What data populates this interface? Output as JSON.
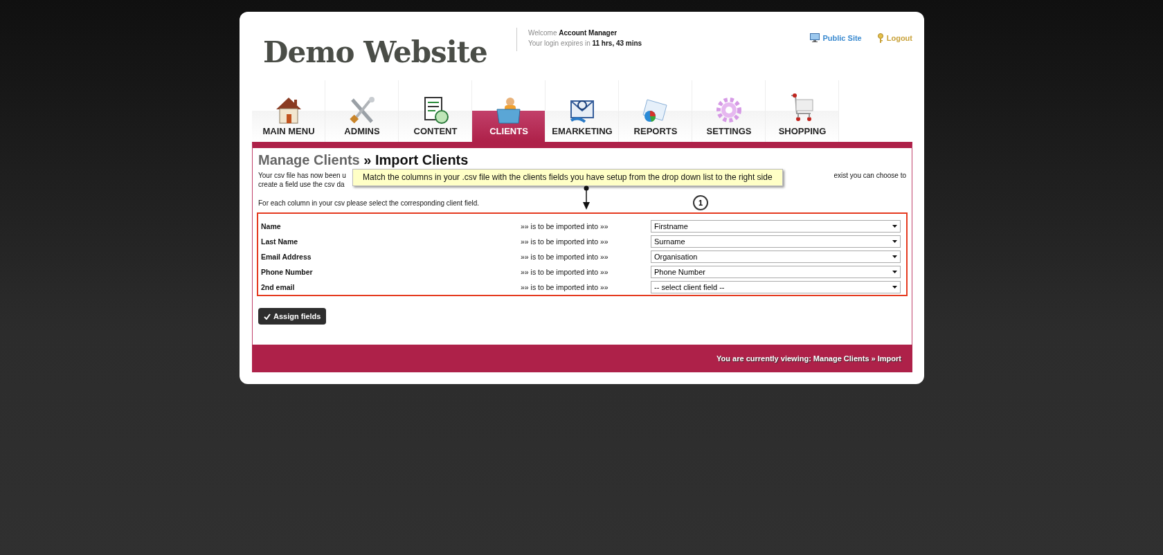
{
  "site": {
    "logo": "Demo Website",
    "welcome_label": "Welcome",
    "user": "Account Manager",
    "expiry_label": "Your login expires in",
    "expiry": "11 hrs, 43 mins",
    "links": [
      {
        "label": "Public Site",
        "kind": "monitor"
      },
      {
        "label": "Logout",
        "kind": "key"
      }
    ]
  },
  "tabs": [
    {
      "label": "MAIN MENU",
      "selected": false
    },
    {
      "label": "ADMINS",
      "selected": false
    },
    {
      "label": "CONTENT",
      "selected": false
    },
    {
      "label": "CLIENTS",
      "selected": true
    },
    {
      "label": "EMARKETING",
      "selected": false
    },
    {
      "label": "REPORTS",
      "selected": false
    },
    {
      "label": "SETTINGS",
      "selected": false
    },
    {
      "label": "SHOPPING",
      "selected": false
    }
  ],
  "page": {
    "breadcrumb_parent": "Manage Clients",
    "separator": "»",
    "title": "Import Clients",
    "intro_line1_start": "Your csv file has now been u",
    "intro_line1_end": "exist you can choose to",
    "intro_line2_start": "create a field use the csv da",
    "instruction": "For each column in your csv please select the corresponding client field.",
    "tooltip": "Match the columns in your .csv file with the clients fields you have setup from the drop down list to the right side",
    "callout": "1",
    "mappings": [
      {
        "column": "Name",
        "connector": "»» is to be imported into »»",
        "field": "Firstname"
      },
      {
        "column": "Last Name",
        "connector": "»» is to be imported into »»",
        "field": "Surname"
      },
      {
        "column": "Email Address",
        "connector": "»» is to be imported into »»",
        "field": "Organisation"
      },
      {
        "column": "Phone Number",
        "connector": "»» is to be imported into »»",
        "field": "Phone Number"
      },
      {
        "column": "2nd email",
        "connector": "»» is to be imported into »»",
        "field": "-- select client field --"
      }
    ],
    "submit": "Assign fields"
  },
  "footer": {
    "viewing": "You are currently viewing: Manage Clients » Import"
  }
}
